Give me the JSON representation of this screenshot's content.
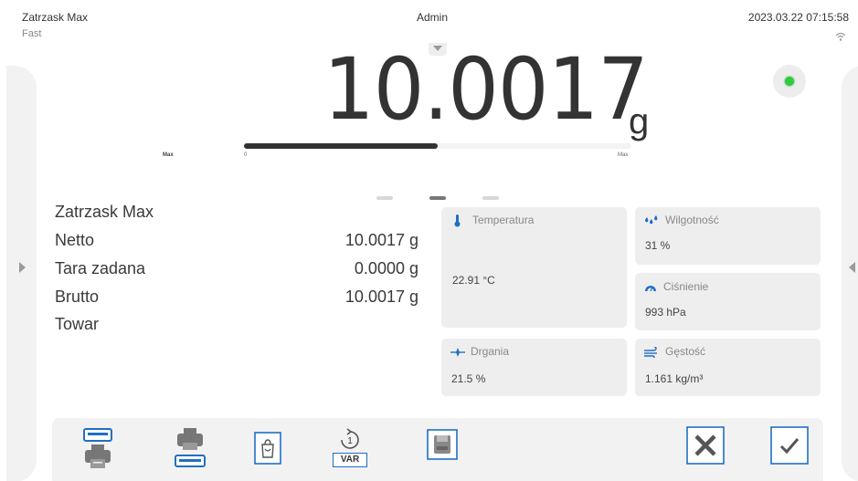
{
  "status_bar": {
    "app_name": "Zatrzask Max",
    "mode": "Fast",
    "user": "Admin",
    "datetime": "2023.03.22 07:15:58"
  },
  "weight": {
    "value": "10.0017",
    "unit": "g",
    "stable": true
  },
  "bargraph": {
    "label_left": "Max",
    "min_label": "0",
    "max_label": "Max",
    "fill_fraction": 0.5
  },
  "page_indicator": {
    "count": 3,
    "active_index": 1
  },
  "info": {
    "title": "Zatrzask Max",
    "rows": [
      {
        "label": "Netto",
        "value": "10.0017 g"
      },
      {
        "label": "Tara zadana",
        "value": "0.0000 g"
      },
      {
        "label": "Brutto",
        "value": "10.0017 g"
      },
      {
        "label": "Towar",
        "value": ""
      }
    ]
  },
  "tiles": {
    "temperature": {
      "title": "Temperatura",
      "value": "22.91 °C",
      "icon": "thermometer-icon"
    },
    "humidity": {
      "title": "Wilgotność",
      "value": "31 %",
      "icon": "humidity-drops-icon"
    },
    "pressure": {
      "title": "Ciśnienie",
      "value": "993 hPa",
      "icon": "barometer-icon"
    },
    "vibration": {
      "title": "Drgania",
      "value": "21.5 %",
      "icon": "vibration-icon"
    },
    "density": {
      "title": "Gęstość",
      "value": "1.161 kg/m³",
      "icon": "wind-density-icon"
    }
  },
  "toolbar": {
    "var_label": "VAR",
    "buttons": [
      "print-header-button",
      "print-footer-button",
      "tare-product-button",
      "variable-button",
      "save-button",
      "cancel-button",
      "accept-button"
    ]
  },
  "colors": {
    "accent_blue": "#1f6fc5",
    "tile_bg": "#eeeeee",
    "led_green": "#2ecc40"
  }
}
